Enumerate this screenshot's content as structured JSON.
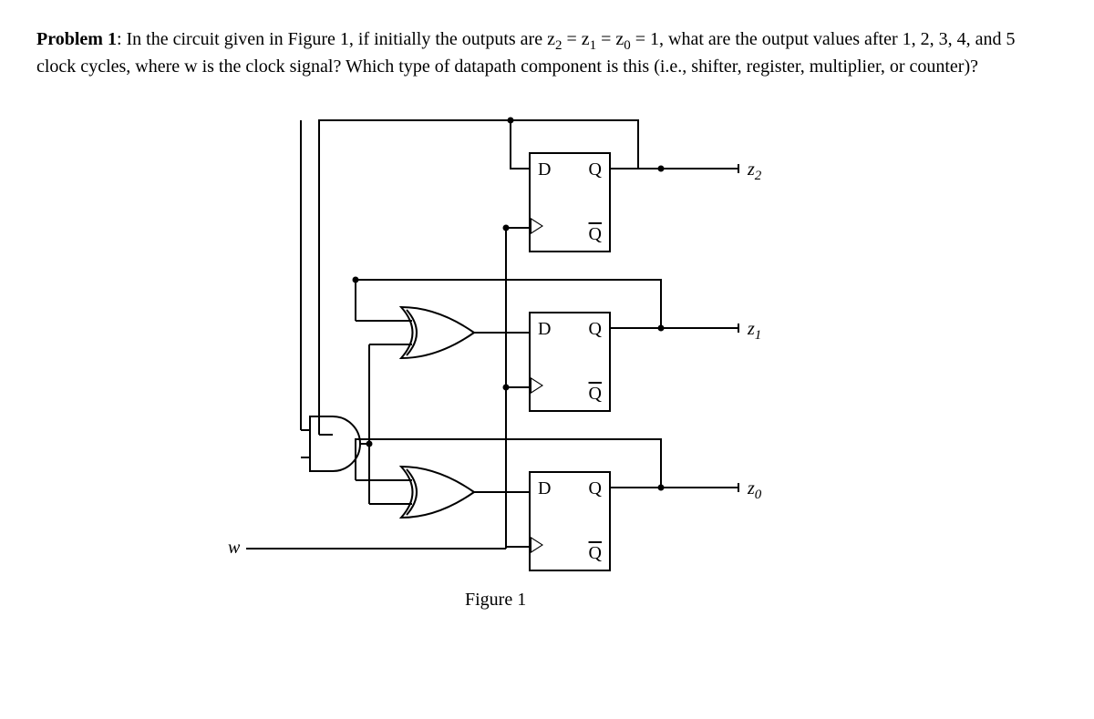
{
  "problem": {
    "label": "Problem 1",
    "text_part1": ": In the circuit given in Figure 1, if initially the outputs are z",
    "sub2": "2",
    "text_eq1": " = z",
    "sub1": "1",
    "text_eq2": " = z",
    "sub0": "0",
    "text_part2": " = 1, what are the output values after 1, 2, 3, 4, and 5 clock cycles, where w is the clock signal? Which type of datapath component is this (i.e., shifter, register, multiplier, or counter)?"
  },
  "flipflop": {
    "D": "D",
    "Q": "Q",
    "Qbar": "Q"
  },
  "outputs": {
    "z2": "z",
    "z2sub": "2",
    "z1": "z",
    "z1sub": "1",
    "z0": "z",
    "z0sub": "0"
  },
  "input": {
    "w": "w"
  },
  "caption": "Figure 1"
}
